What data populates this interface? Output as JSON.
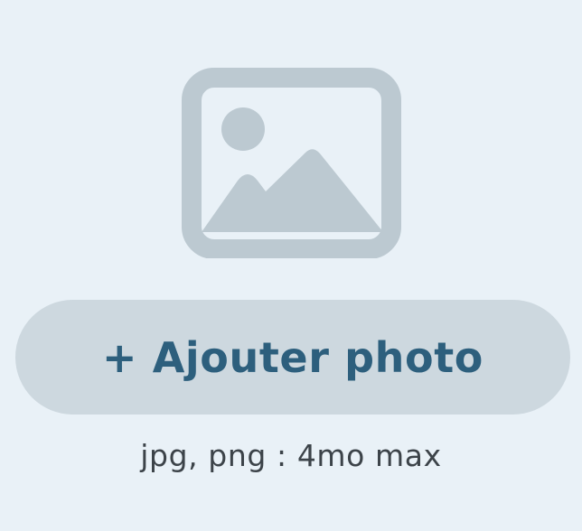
{
  "upload": {
    "icon": "image-placeholder-icon",
    "button_label": "+ Ajouter photo",
    "hint": "jpg, png : 4mo max"
  },
  "colors": {
    "background": "#e9f1f7",
    "icon": "#bcc9d1",
    "button_bg": "#cdd8df",
    "button_text": "#2d5f7d",
    "hint_text": "#3c4349"
  }
}
